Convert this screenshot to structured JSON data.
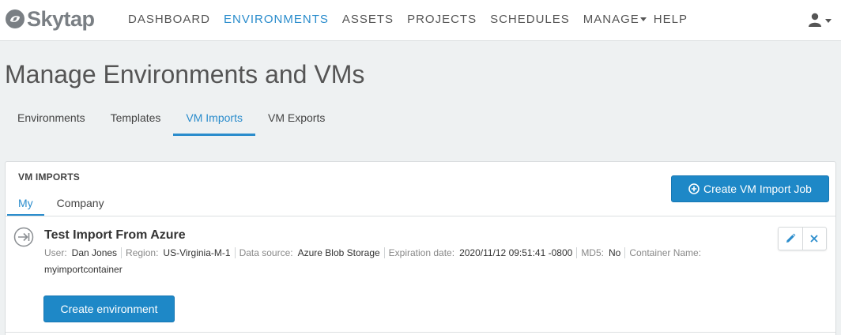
{
  "brand": {
    "name": "Skytap"
  },
  "nav": {
    "items": [
      {
        "label": "DASHBOARD",
        "active": false
      },
      {
        "label": "ENVIRONMENTS",
        "active": true
      },
      {
        "label": "ASSETS",
        "active": false
      },
      {
        "label": "PROJECTS",
        "active": false
      },
      {
        "label": "SCHEDULES",
        "active": false
      },
      {
        "label": "MANAGE",
        "active": false,
        "dropdown": true
      },
      {
        "label": "HELP",
        "active": false
      }
    ],
    "user_icon": "user-icon"
  },
  "page": {
    "title": "Manage Environments and VMs"
  },
  "subtabs": [
    {
      "label": "Environments",
      "active": false
    },
    {
      "label": "Templates",
      "active": false
    },
    {
      "label": "VM Imports",
      "active": true
    },
    {
      "label": "VM Exports",
      "active": false
    }
  ],
  "panel": {
    "title": "VM IMPORTS",
    "tabs": [
      {
        "label": "My",
        "active": true
      },
      {
        "label": "Company",
        "active": false
      }
    ],
    "create_button": {
      "label": "Create VM Import Job",
      "icon": "plus-circle-icon"
    }
  },
  "import_job": {
    "title": "Test Import From Azure",
    "status_icon": "import-arrow-icon",
    "fields": [
      {
        "label": "User:",
        "value": "Dan Jones"
      },
      {
        "label": "Region:",
        "value": "US-Virginia-M-1"
      },
      {
        "label": "Data source:",
        "value": "Azure Blob Storage"
      },
      {
        "label": "Expiration date:",
        "value": "2020/11/12 09:51:41 -0800"
      },
      {
        "label": "MD5:",
        "value": "No"
      },
      {
        "label": "Container Name:",
        "value": "myimportcontainer"
      }
    ],
    "create_env_label": "Create environment",
    "actions": {
      "edit_icon": "pencil-icon",
      "delete_icon": "close-icon"
    }
  },
  "colors": {
    "accent": "#2a8ccc",
    "button": "#1e88c7",
    "background": "#eef1f2"
  }
}
